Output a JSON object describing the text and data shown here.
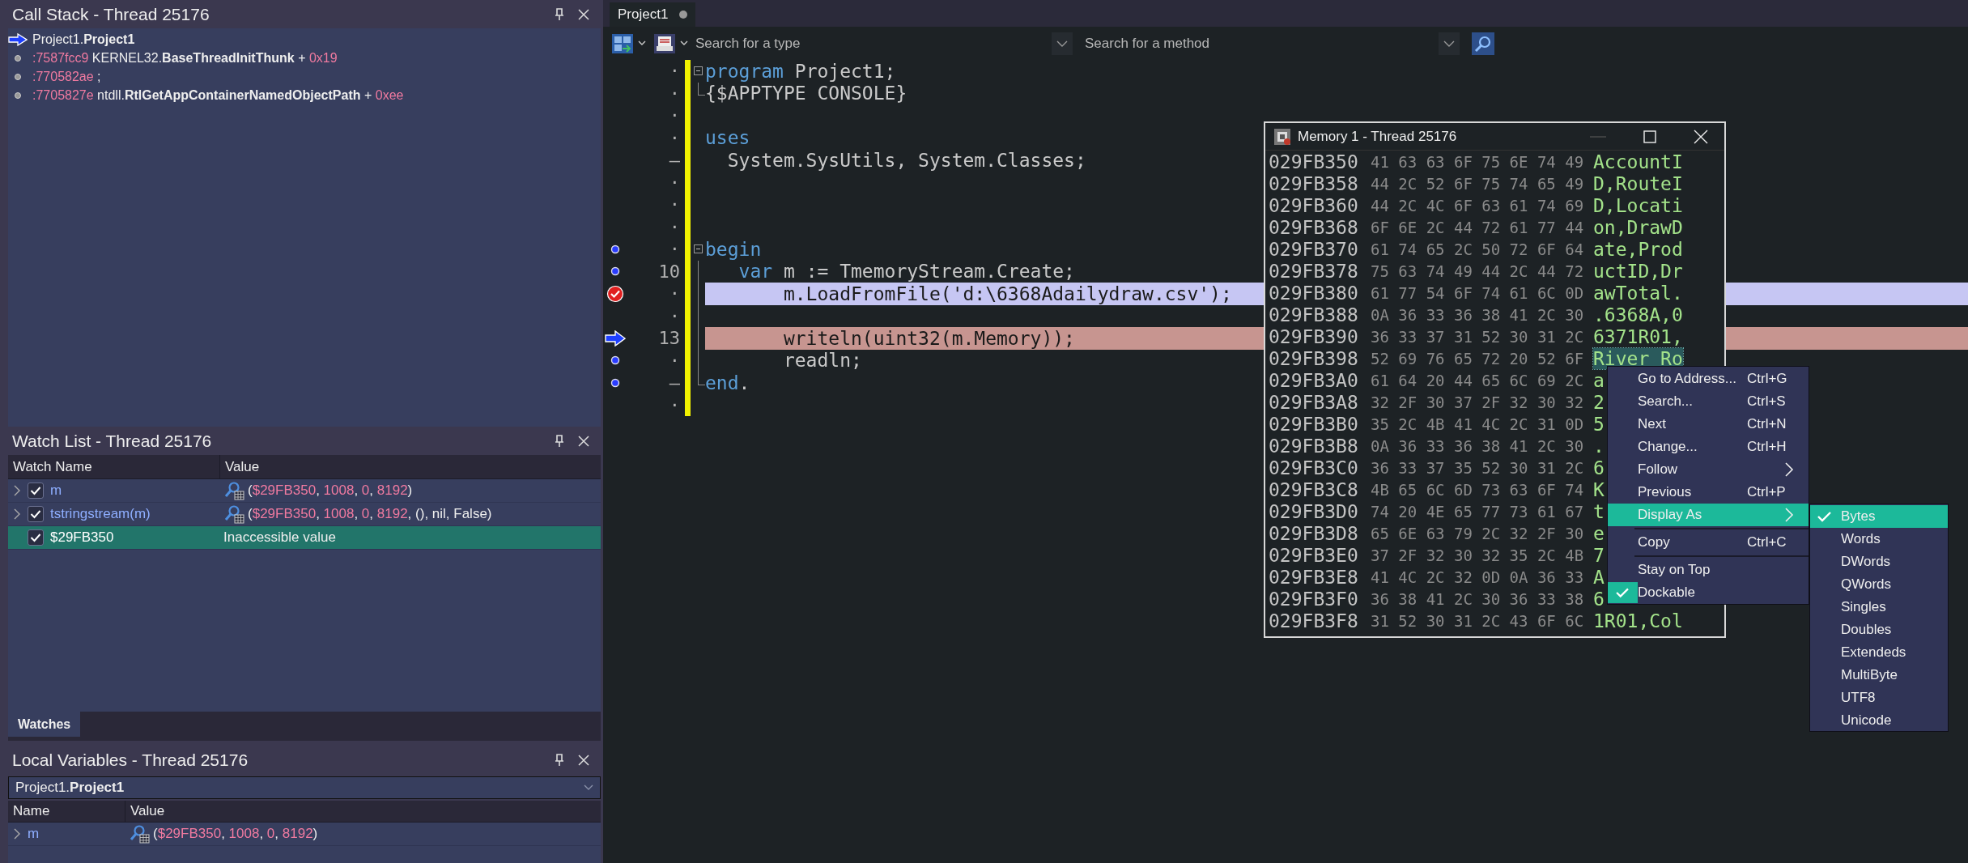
{
  "call_stack": {
    "title": "Call Stack - Thread 25176",
    "frames": [
      {
        "current": true,
        "text": "Project1.**Project1**"
      },
      {
        "current": false,
        "address": ":7587fcc9",
        "text": "KERNEL32.**BaseThreadInitThunk** +",
        "offset": "0x19"
      },
      {
        "current": false,
        "address": ":770582ae",
        "text": ";"
      },
      {
        "current": false,
        "address": ":7705827e",
        "text": "ntdll.**RtlGetAppContainerNamedObjectPath** +",
        "offset": "0xee"
      }
    ]
  },
  "watch_list": {
    "title": "Watch List - Thread 25176",
    "columns": [
      "Watch Name",
      "Value"
    ],
    "rows": [
      {
        "expandable": true,
        "checked": true,
        "selected": false,
        "name": "m",
        "inspectable": true,
        "value": [
          {
            "kind": "punct",
            "text": "("
          },
          {
            "kind": "number",
            "text": "$29FB350"
          },
          {
            "kind": "punct",
            "text": ", "
          },
          {
            "kind": "number",
            "text": "1008"
          },
          {
            "kind": "punct",
            "text": ", "
          },
          {
            "kind": "number",
            "text": "0"
          },
          {
            "kind": "punct",
            "text": ", "
          },
          {
            "kind": "number",
            "text": "8192"
          },
          {
            "kind": "punct",
            "text": ")"
          }
        ]
      },
      {
        "expandable": true,
        "checked": true,
        "selected": false,
        "name": "tstringstream(m)",
        "inspectable": true,
        "value": [
          {
            "kind": "punct",
            "text": "("
          },
          {
            "kind": "number",
            "text": "$29FB350"
          },
          {
            "kind": "punct",
            "text": ", "
          },
          {
            "kind": "number",
            "text": "1008"
          },
          {
            "kind": "punct",
            "text": ", "
          },
          {
            "kind": "number",
            "text": "0"
          },
          {
            "kind": "punct",
            "text": ", "
          },
          {
            "kind": "number",
            "text": "8192"
          },
          {
            "kind": "punct",
            "text": ", (), nil, False)"
          }
        ]
      },
      {
        "expandable": false,
        "checked": true,
        "selected": true,
        "name": "$29FB350",
        "inspectable": false,
        "value": [
          {
            "kind": "punct",
            "text": "Inaccessible value"
          }
        ]
      }
    ],
    "tabs": [
      {
        "label": "Watches",
        "selected": true
      }
    ]
  },
  "local_variables": {
    "title": "Local Variables - Thread 25176",
    "scope": "Project1.**Project1**",
    "columns": [
      "Name",
      "Value"
    ],
    "rows": [
      {
        "expandable": true,
        "name": "m",
        "inspectable": true,
        "value": [
          {
            "kind": "punct",
            "text": "("
          },
          {
            "kind": "number",
            "text": "$29FB350"
          },
          {
            "kind": "punct",
            "text": ", "
          },
          {
            "kind": "number",
            "text": "1008"
          },
          {
            "kind": "punct",
            "text": ", "
          },
          {
            "kind": "number",
            "text": "0"
          },
          {
            "kind": "punct",
            "text": ", "
          },
          {
            "kind": "number",
            "text": "8192"
          },
          {
            "kind": "punct",
            "text": ")"
          }
        ]
      }
    ]
  },
  "editor": {
    "tabs": [
      {
        "label": "Project1",
        "modified": true,
        "selected": true
      }
    ],
    "toolbar": {
      "type_search": {
        "placeholder": "Search for a type"
      },
      "method_search": {
        "placeholder": "Search for a method"
      }
    },
    "lines": [
      {
        "gutter": "·",
        "fold": {
          "kind": "start"
        },
        "tokens": [
          {
            "kind": "keyword",
            "text": "program"
          },
          {
            "kind": "plain",
            "text": " Project1;"
          }
        ]
      },
      {
        "gutter": "·",
        "fold": {
          "kind": "end"
        },
        "tokens": [
          {
            "kind": "plain",
            "text": "{$APPTYPE CONSOLE}"
          }
        ]
      },
      {
        "gutter": "·"
      },
      {
        "gutter": "·",
        "tokens": [
          {
            "kind": "keyword",
            "text": "uses"
          }
        ]
      },
      {
        "gutter": "–",
        "tokens": [
          {
            "kind": "plain",
            "text": "  System.SysUtils, System.Classes;"
          }
        ]
      },
      {
        "gutter": "·"
      },
      {
        "gutter": "·"
      },
      {
        "gutter": "·"
      },
      {
        "gutter": "·",
        "marker": {
          "kind": "dot"
        },
        "fold": {
          "kind": "start"
        },
        "tokens": [
          {
            "kind": "keyword",
            "text": "begin"
          }
        ]
      },
      {
        "gutter": "10",
        "marker": {
          "kind": "dot"
        },
        "fold": {
          "kind": "mid"
        },
        "tokens": [
          {
            "kind": "keyword",
            "text": "   var"
          },
          {
            "kind": "plain",
            "text": " m := TmemoryStream.Create;"
          }
        ]
      },
      {
        "gutter": "·",
        "marker": {
          "kind": "breakpoint"
        },
        "fold": {
          "kind": "mid"
        },
        "highlight": {
          "kind": "breakpoint"
        },
        "tokens": [
          {
            "kind": "plain",
            "text": "       m.LoadFromFile('d:\\6368Adailydraw.csv');"
          }
        ]
      },
      {
        "gutter": "·",
        "fold": {
          "kind": "mid"
        }
      },
      {
        "gutter": "13",
        "marker": {
          "kind": "current"
        },
        "fold": {
          "kind": "mid"
        },
        "highlight": {
          "kind": "execution"
        },
        "tokens": [
          {
            "kind": "plain",
            "text": "       writeln(uint32(m.Memory));"
          }
        ]
      },
      {
        "gutter": "·",
        "marker": {
          "kind": "dot"
        },
        "fold": {
          "kind": "mid"
        },
        "tokens": [
          {
            "kind": "plain",
            "text": "       readln;"
          }
        ]
      },
      {
        "gutter": "–",
        "marker": {
          "kind": "dot"
        },
        "fold": {
          "kind": "end"
        },
        "tokens": [
          {
            "kind": "keyword",
            "text": "end"
          },
          {
            "kind": "plain",
            "text": "."
          }
        ]
      },
      {
        "gutter": "·"
      }
    ]
  },
  "memory_window": {
    "title": "Memory 1 - Thread 25176",
    "rows": [
      {
        "address": "029FB350",
        "bytes": "41 63 63 6F 75 6E 74 49",
        "ascii": "AccountI",
        "selected": false
      },
      {
        "address": "029FB358",
        "bytes": "44 2C 52 6F 75 74 65 49",
        "ascii": "D,RouteI",
        "selected": false
      },
      {
        "address": "029FB360",
        "bytes": "44 2C 4C 6F 63 61 74 69",
        "ascii": "D,Locati",
        "selected": false
      },
      {
        "address": "029FB368",
        "bytes": "6F 6E 2C 44 72 61 77 44",
        "ascii": "on,DrawD",
        "selected": false
      },
      {
        "address": "029FB370",
        "bytes": "61 74 65 2C 50 72 6F 64",
        "ascii": "ate,Prod",
        "selected": false
      },
      {
        "address": "029FB378",
        "bytes": "75 63 74 49 44 2C 44 72",
        "ascii": "uctID,Dr",
        "selected": false
      },
      {
        "address": "029FB380",
        "bytes": "61 77 54 6F 74 61 6C 0D",
        "ascii": "awTotal.",
        "selected": false
      },
      {
        "address": "029FB388",
        "bytes": "0A 36 33 36 38 41 2C 30",
        "ascii": ".6368A,0",
        "selected": false
      },
      {
        "address": "029FB390",
        "bytes": "36 33 37 31 52 30 31 2C",
        "ascii": "6371R01,",
        "selected": false
      },
      {
        "address": "029FB398",
        "bytes": "52 69 76 65 72 20 52 6F",
        "ascii": "River Ro",
        "selected": true
      },
      {
        "address": "029FB3A0",
        "bytes": "61 64 20 44 65 6C 69 2C",
        "ascii": "a",
        "selected": false
      },
      {
        "address": "029FB3A8",
        "bytes": "32 2F 30 37 2F 32 30 32",
        "ascii": "2",
        "selected": false
      },
      {
        "address": "029FB3B0",
        "bytes": "35 2C 4B 41 4C 2C 31 0D",
        "ascii": "5",
        "selected": false
      },
      {
        "address": "029FB3B8",
        "bytes": "0A 36 33 36 38 41 2C 30",
        "ascii": ".",
        "selected": false
      },
      {
        "address": "029FB3C0",
        "bytes": "36 33 37 35 52 30 31 2C",
        "ascii": "6",
        "selected": false
      },
      {
        "address": "029FB3C8",
        "bytes": "4B 65 6C 6D 73 63 6F 74",
        "ascii": "K",
        "selected": false
      },
      {
        "address": "029FB3D0",
        "bytes": "74 20 4E 65 77 73 61 67",
        "ascii": "t",
        "selected": false
      },
      {
        "address": "029FB3D8",
        "bytes": "65 6E 63 79 2C 32 2F 30",
        "ascii": "e",
        "selected": false
      },
      {
        "address": "029FB3E0",
        "bytes": "37 2F 32 30 32 35 2C 4B",
        "ascii": "7",
        "selected": false
      },
      {
        "address": "029FB3E8",
        "bytes": "41 4C 2C 32 0D 0A 36 33",
        "ascii": "A",
        "selected": false
      },
      {
        "address": "029FB3F0",
        "bytes": "36 38 41 2C 30 36 33 38",
        "ascii": "6",
        "selected": false
      },
      {
        "address": "029FB3F8",
        "bytes": "31 52 30 31 2C 43 6F 6C",
        "ascii": "1R01,Col",
        "selected": false
      }
    ]
  },
  "context_menu": {
    "items": [
      {
        "label": "Go to Address...",
        "shortcut": "Ctrl+G",
        "submenu": false,
        "checked": false,
        "selected": false,
        "separator_before": false
      },
      {
        "label": "Search...",
        "shortcut": "Ctrl+S",
        "submenu": false,
        "checked": false,
        "selected": false,
        "separator_before": false
      },
      {
        "label": "Next",
        "shortcut": "Ctrl+N",
        "submenu": false,
        "checked": false,
        "selected": false,
        "separator_before": false
      },
      {
        "label": "Change...",
        "shortcut": "Ctrl+H",
        "submenu": false,
        "checked": false,
        "selected": false,
        "separator_before": false
      },
      {
        "label": "Follow",
        "submenu": true,
        "checked": false,
        "selected": false,
        "separator_before": false
      },
      {
        "label": "Previous",
        "shortcut": "Ctrl+P",
        "submenu": false,
        "checked": false,
        "selected": false,
        "separator_before": false
      },
      {
        "label": "Display As",
        "submenu": true,
        "checked": false,
        "selected": true,
        "separator_before": false
      },
      {
        "label": "Copy",
        "shortcut": "Ctrl+C",
        "submenu": false,
        "checked": false,
        "selected": false,
        "separator_before": true
      },
      {
        "label": "Stay on Top",
        "submenu": false,
        "checked": false,
        "selected": false,
        "separator_before": true
      },
      {
        "label": "Dockable",
        "submenu": false,
        "checked": true,
        "selected": false,
        "separator_before": false
      }
    ]
  },
  "submenu": {
    "items": [
      {
        "label": "Bytes",
        "checked": true,
        "selected": true
      },
      {
        "label": "Words",
        "checked": false,
        "selected": false
      },
      {
        "label": "DWords",
        "checked": false,
        "selected": false
      },
      {
        "label": "QWords",
        "checked": false,
        "selected": false
      },
      {
        "label": "Singles",
        "checked": false,
        "selected": false
      },
      {
        "label": "Doubles",
        "checked": false,
        "selected": false
      },
      {
        "label": "Extendeds",
        "checked": false,
        "selected": false
      },
      {
        "label": "MultiByte",
        "checked": false,
        "selected": false
      },
      {
        "label": "UTF8",
        "checked": false,
        "selected": false
      },
      {
        "label": "Unicode",
        "checked": false,
        "selected": false
      }
    ]
  }
}
